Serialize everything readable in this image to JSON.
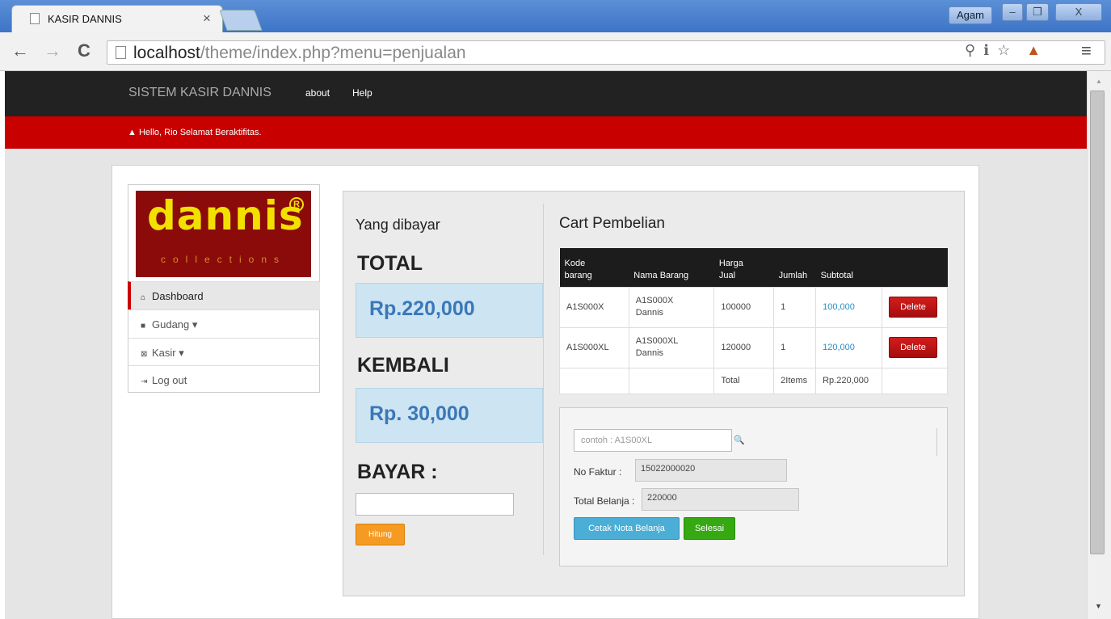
{
  "browser": {
    "tab_title": "KASIR DANNIS",
    "tab_close": "×",
    "url_host": "localhost",
    "url_path": "/theme/index.php?menu=penjualan",
    "user": "Agam",
    "min_btn": "–",
    "restore_btn": "❐",
    "close_btn": "X",
    "back_icon": "←",
    "forward_icon": "→",
    "reload_icon": "C",
    "zoom_icon": "⚲",
    "translate_icon": "ℹ",
    "star_icon": "☆",
    "ext_icon": "▲",
    "menu_icon": "≡",
    "scroll_up": "▲",
    "scroll_down": "▼"
  },
  "nav": {
    "brand": "SISTEM KASIR DANNIS",
    "links": [
      "about",
      "Help"
    ]
  },
  "greeting": "Hello, Rio Selamat Beraktifitas.",
  "greeting_icon": "▲",
  "logo": {
    "word": "dannis",
    "reg": "R",
    "tagline": "collections"
  },
  "sidebar": {
    "items": [
      {
        "label": "Dashboard",
        "icon": "⌂"
      },
      {
        "label": "Gudang ▾",
        "icon": "■"
      },
      {
        "label": "Kasir ▾",
        "icon": "⊠"
      },
      {
        "label": "Log out",
        "icon": "⇥"
      }
    ]
  },
  "payment": {
    "title": "Yang dibayar",
    "total_label": "TOTAL",
    "total_value": "Rp.220,000",
    "kembali_label": "KEMBALI",
    "kembali_value": "Rp. 30,000",
    "bayar_label": "BAYAR :",
    "hitung_button": "Hitung"
  },
  "cart": {
    "title": "Cart Pembelian",
    "headers": [
      "Kode\nbarang",
      "Nama Barang",
      "Harga\nJual",
      "Jumlah",
      "Subtotal",
      ""
    ],
    "rows": [
      {
        "kode": "A1S000X",
        "nama": "A1S000X\nDannis",
        "harga": "100000",
        "jumlah": "1",
        "subtotal": "100,000",
        "action": "Delete"
      },
      {
        "kode": "A1S000XL",
        "nama": "A1S000XL\nDannis",
        "harga": "120000",
        "jumlah": "1",
        "subtotal": "120,000",
        "action": "Delete"
      }
    ],
    "total_row": {
      "label": "Total",
      "items": "2Items",
      "amount": "Rp.220,000"
    }
  },
  "form": {
    "kode_placeholder": "contoh : A1S00XL",
    "search_icon": "🔍",
    "faktur_label": "No Faktur :",
    "faktur_value": "15022000020",
    "belanja_label": "Total Belanja :",
    "belanja_value": "220000",
    "cetak_button": "Cetak Nota Belanja",
    "selesai_button": "Selesai"
  }
}
